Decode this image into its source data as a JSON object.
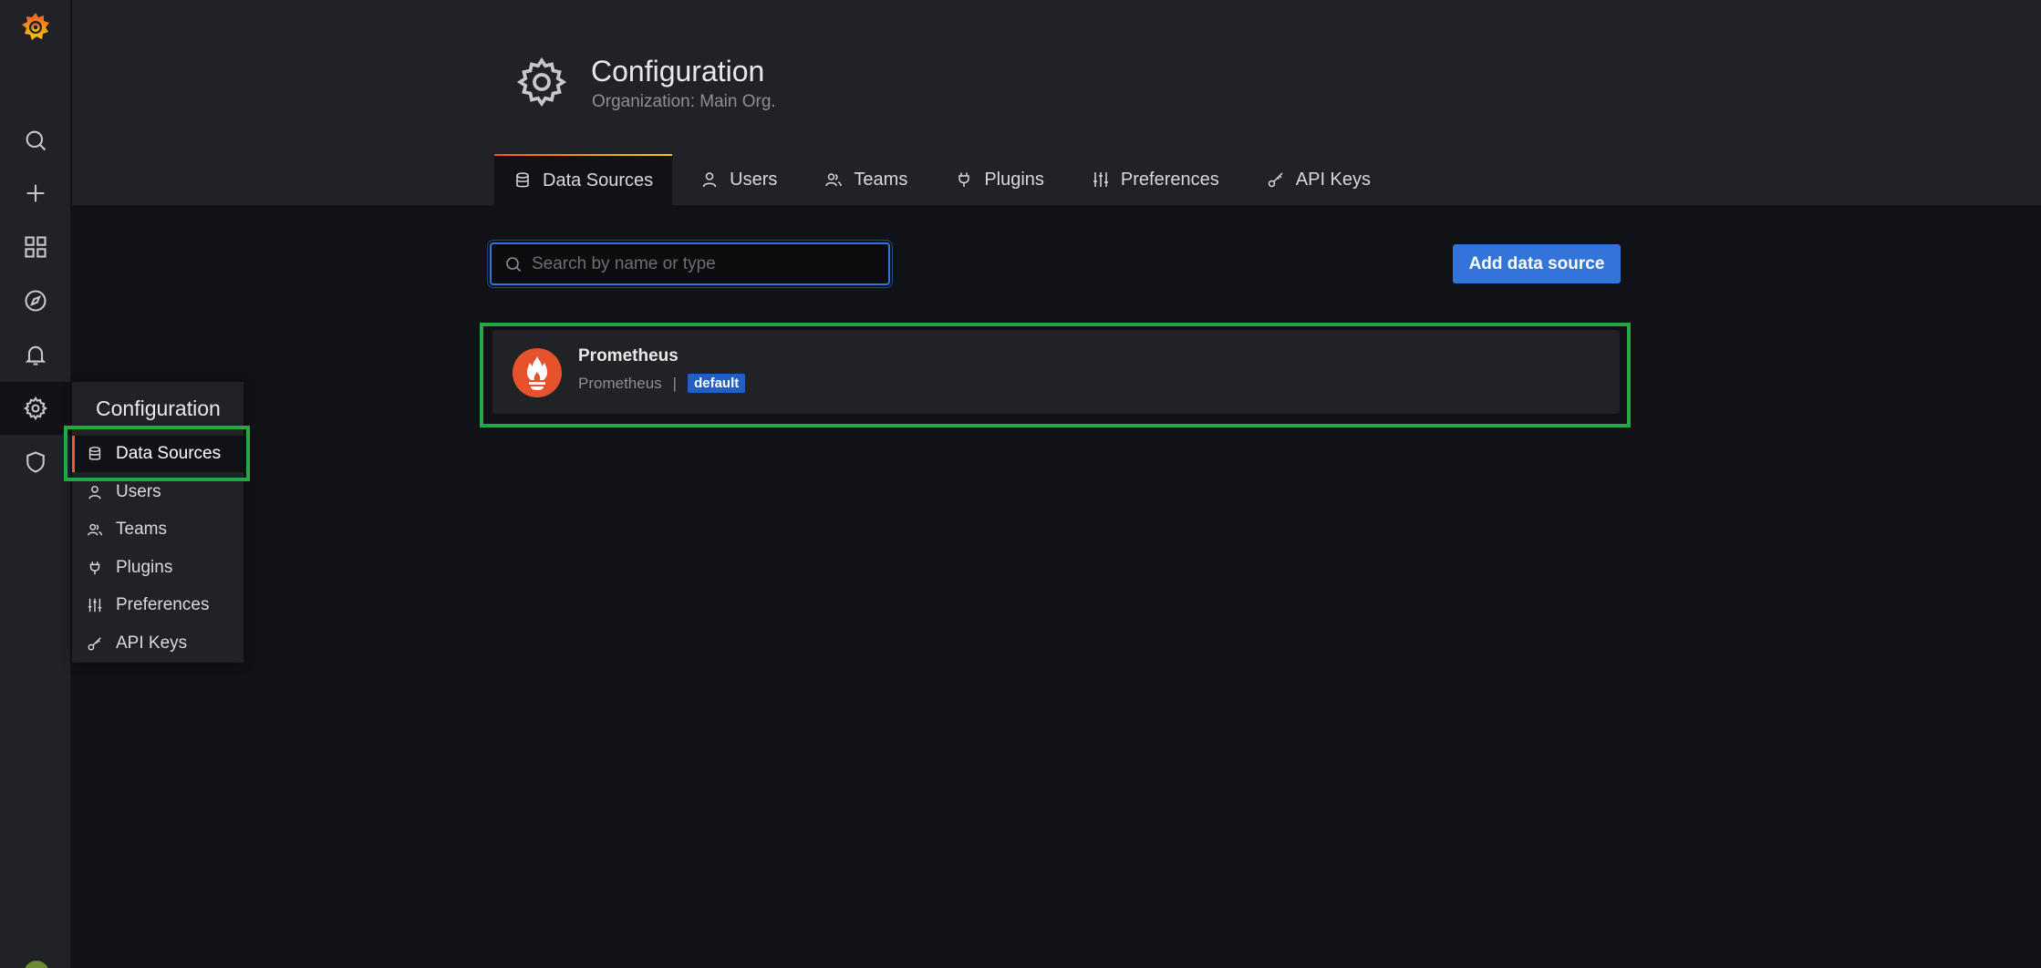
{
  "page": {
    "title": "Configuration",
    "subtitle": "Organization: Main Org."
  },
  "tabs": [
    {
      "label": "Data Sources",
      "icon": "database-icon",
      "active": true
    },
    {
      "label": "Users",
      "icon": "user-icon"
    },
    {
      "label": "Teams",
      "icon": "users-icon"
    },
    {
      "label": "Plugins",
      "icon": "plug-icon"
    },
    {
      "label": "Preferences",
      "icon": "sliders-icon"
    },
    {
      "label": "API Keys",
      "icon": "key-icon"
    }
  ],
  "search": {
    "placeholder": "Search by name or type",
    "value": ""
  },
  "toolbar": {
    "add_label": "Add data source"
  },
  "datasources": [
    {
      "name": "Prometheus",
      "type": "Prometheus",
      "separator": "|",
      "badge": "default"
    }
  ],
  "sidebar": {
    "items": [
      {
        "icon": "search-icon"
      },
      {
        "icon": "plus-icon"
      },
      {
        "icon": "dashboards-icon"
      },
      {
        "icon": "compass-icon"
      },
      {
        "icon": "bell-icon"
      },
      {
        "icon": "gear-icon",
        "active": true
      },
      {
        "icon": "shield-icon"
      }
    ]
  },
  "flyout": {
    "title": "Configuration",
    "items": [
      {
        "label": "Data Sources",
        "icon": "database-icon",
        "active": true
      },
      {
        "label": "Users",
        "icon": "user-icon"
      },
      {
        "label": "Teams",
        "icon": "users-icon"
      },
      {
        "label": "Plugins",
        "icon": "plug-icon"
      },
      {
        "label": "Preferences",
        "icon": "sliders-icon"
      },
      {
        "label": "API Keys",
        "icon": "key-icon"
      }
    ]
  },
  "colors": {
    "accent": "#3274d9",
    "highlight": "#23a943",
    "brand": "#f05a28",
    "badge": "#1f60c4"
  }
}
